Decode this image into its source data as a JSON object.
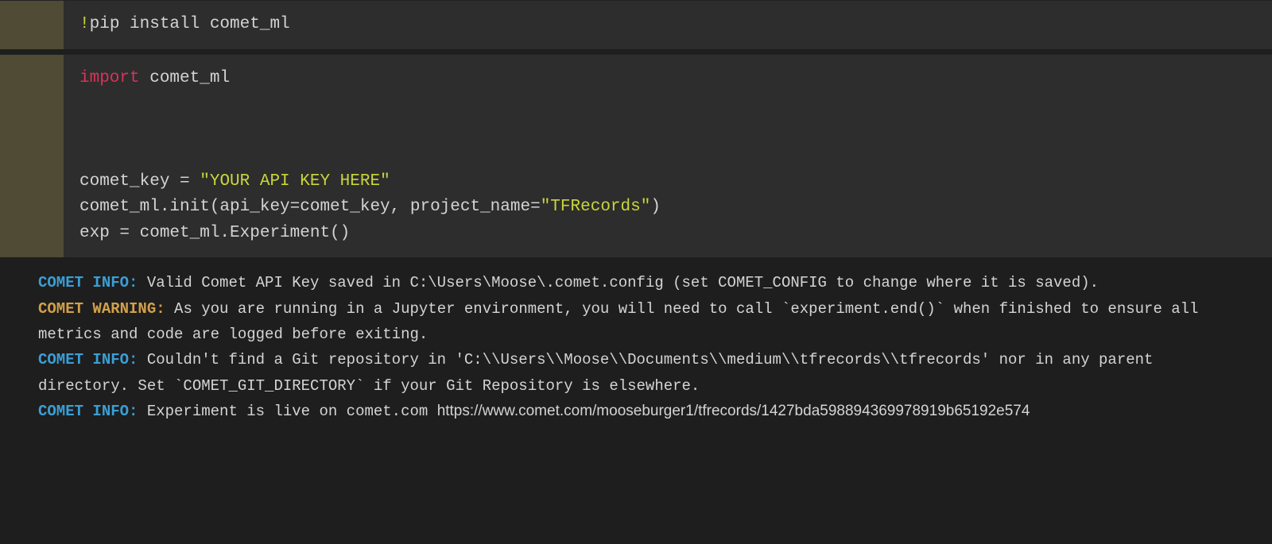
{
  "colors": {
    "bang": "#c9d53a",
    "keyword": "#d9325a",
    "string": "#c9d53a",
    "info": "#3a9fd6",
    "warn": "#d2a04a"
  },
  "cell1": {
    "tokens": {
      "bang": "!",
      "rest": "pip install comet_ml"
    }
  },
  "cell2": {
    "line1": {
      "kw": "import",
      "rest": " comet_ml"
    },
    "line5": {
      "pre": "comet_key = ",
      "str": "\"YOUR API KEY HERE\""
    },
    "line6": {
      "pre": "comet_ml.init(api_key=comet_key, project_name=",
      "str": "\"TFRecords\"",
      "post": ")"
    },
    "line7": {
      "text": "exp = comet_ml.Experiment()"
    }
  },
  "output": {
    "l1": {
      "tag": "COMET INFO:",
      "text": " Valid Comet API Key saved in C:\\Users\\Moose\\.comet.config (set COMET_CONFIG to change where it is saved)."
    },
    "l2": {
      "tag": "COMET WARNING:",
      "text": " As you are running in a Jupyter environment, you will need to call `experiment.end()` when finished to ensure all metrics and code are logged before exiting."
    },
    "l3": {
      "tag": "COMET INFO:",
      "text": " Couldn't find a Git repository in 'C:\\\\Users\\\\Moose\\\\Documents\\\\medium\\\\tfrecords\\\\tfrecords' nor in any parent directory. Set `COMET_GIT_DIRECTORY` if your Git Repository is elsewhere."
    },
    "l4": {
      "tag": "COMET INFO:",
      "text": " Experiment is live on comet.com ",
      "link": "https://www.comet.com/mooseburger1/tfrecords/1427bda598894369978919b65192e574"
    }
  }
}
